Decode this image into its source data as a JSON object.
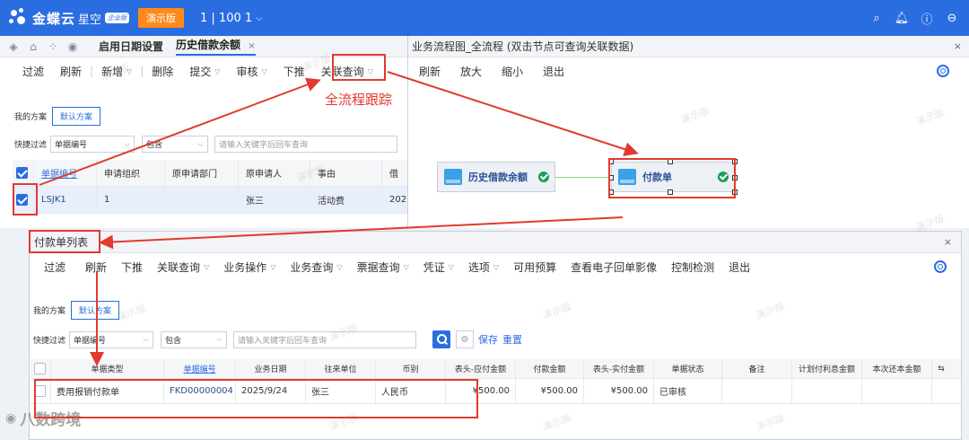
{
  "topbar": {
    "brand": "金蝶云",
    "brand_sub": "星空",
    "badge": "企业版",
    "demo_label": "演示版",
    "org_label": "1 | 100 1",
    "icons": [
      "search-icon",
      "bell-icon",
      "help-icon",
      "minus-circle-icon"
    ]
  },
  "tabs": [
    {
      "label": "启用日期设置"
    },
    {
      "label": "历史借款余额",
      "close": "×"
    }
  ],
  "left_toolbar": [
    "过滤",
    "刷新",
    "新增",
    "删除",
    "提交",
    "审核",
    "下推",
    "关联查询"
  ],
  "left_scheme": {
    "label": "我的方案",
    "button": "默认方案"
  },
  "left_filter": {
    "label": "快捷过滤",
    "field": "单据编号",
    "op": "包含",
    "placeholder": "请输入关键字后回车查询"
  },
  "left_table": {
    "headers": [
      "单据编号",
      "申请组织",
      "原申请部门",
      "原申请人",
      "事由",
      "借"
    ],
    "rows": [
      [
        "LSJK1",
        "1",
        "",
        "张三",
        "活动费",
        "202"
      ]
    ]
  },
  "flow": {
    "title": "业务流程图_全流程  (双击节点可查询关联数据)",
    "close": "×",
    "toolbar": [
      "刷新",
      "放大",
      "缩小",
      "退出"
    ],
    "nodes": [
      "历史借款余额",
      "付款单"
    ]
  },
  "annotation": {
    "text": "全流程跟踪"
  },
  "payment": {
    "title": "付款单列表",
    "close": "×",
    "toolbar": [
      "过滤",
      "刷新",
      "下推",
      "关联查询",
      "业务操作",
      "业务查询",
      "票据查询",
      "凭证",
      "选项",
      "可用预算",
      "查看电子回单影像",
      "控制检测",
      "退出"
    ],
    "scheme_label": "我的方案",
    "scheme_button": "默认方案",
    "filter_label": "快捷过滤",
    "filter_field": "单据编号",
    "filter_op": "包含",
    "filter_placeholder": "请输入关键字后回车查询",
    "save_label": "保存",
    "reset_label": "重置",
    "headers": [
      "单据类型",
      "单据编号",
      "业务日期",
      "往来单位",
      "币别",
      "表头-应付金额",
      "付款金额",
      "表头-实付金额",
      "单据状态",
      "备注",
      "计划付利息金额",
      "本次还本金额"
    ],
    "rows": [
      [
        "费用报销付款单",
        "FKD00000004",
        "2025/9/24",
        "张三",
        "人民币",
        "¥500.00",
        "¥500.00",
        "¥500.00",
        "已审核",
        "",
        "",
        ""
      ]
    ]
  },
  "watermark": "演示版",
  "footer_watermark": "八数跨境"
}
